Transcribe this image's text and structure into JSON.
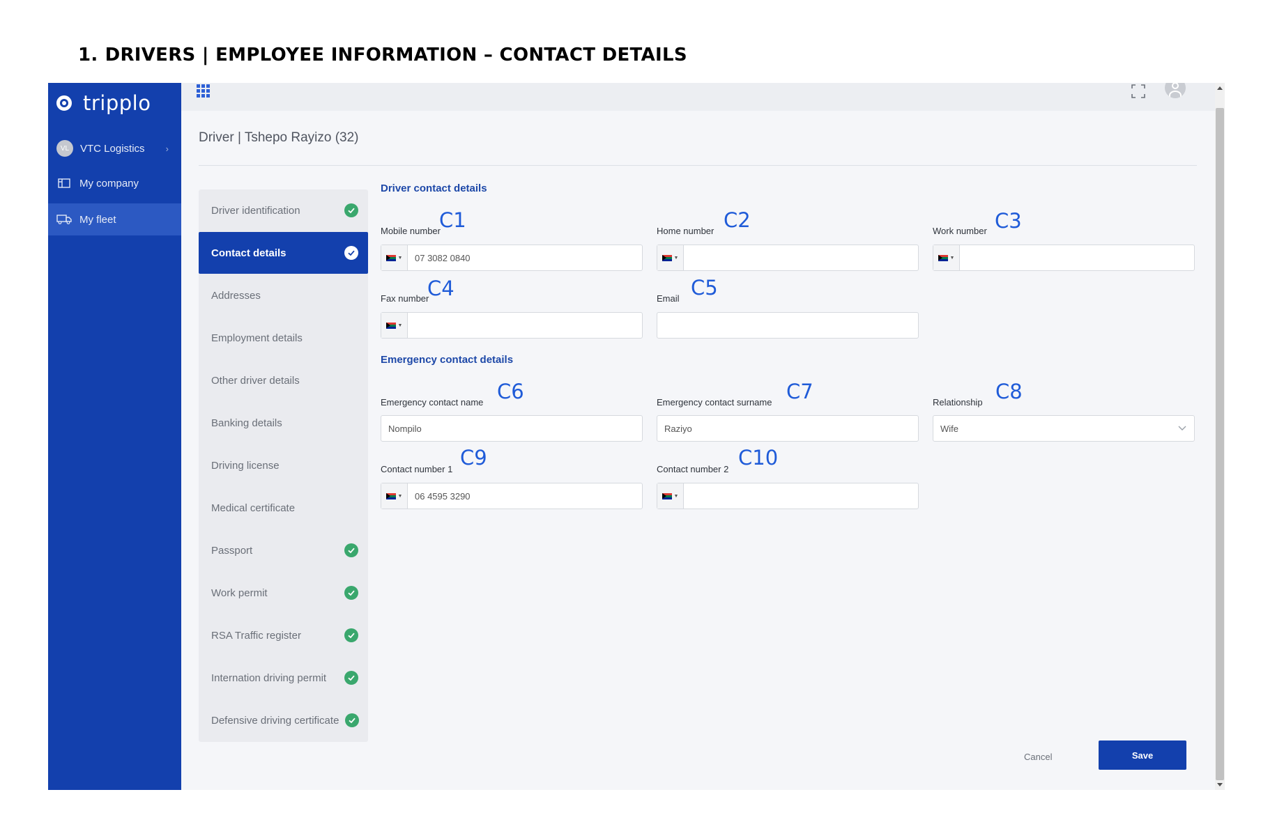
{
  "document": {
    "heading_number": "1.",
    "heading_text": "DRIVERS | EMPLOYEE INFORMATION – CONTACT DETAILS"
  },
  "app": {
    "logo_text": "tripplo",
    "nav": {
      "company_initials": "VL",
      "company_name": "VTC Logistics",
      "my_company": "My company",
      "my_fleet": "My fleet"
    },
    "topbar": {
      "apps_icon": "apps-grid-icon",
      "expand_icon": "expand-icon",
      "user_icon": "user-avatar-icon"
    }
  },
  "page": {
    "title": "Driver | Tshepo Rayizo (32)"
  },
  "tabs": [
    {
      "label": "Driver identification",
      "complete": true,
      "active": false
    },
    {
      "label": "Contact details",
      "complete": true,
      "active": true
    },
    {
      "label": "Addresses",
      "complete": false,
      "active": false
    },
    {
      "label": "Employment details",
      "complete": false,
      "active": false
    },
    {
      "label": "Other driver details",
      "complete": false,
      "active": false
    },
    {
      "label": "Banking details",
      "complete": false,
      "active": false
    },
    {
      "label": "Driving license",
      "complete": false,
      "active": false
    },
    {
      "label": "Medical certificate",
      "complete": false,
      "active": false
    },
    {
      "label": "Passport",
      "complete": true,
      "active": false
    },
    {
      "label": "Work permit",
      "complete": true,
      "active": false
    },
    {
      "label": "RSA Traffic register",
      "complete": true,
      "active": false
    },
    {
      "label": "Internation driving permit",
      "complete": true,
      "active": false
    },
    {
      "label": "Defensive driving certificate",
      "complete": true,
      "active": false
    }
  ],
  "driver_contact": {
    "section_title": "Driver contact details",
    "mobile": {
      "label": "Mobile number",
      "callout": "C1",
      "value": "07 3082 0840"
    },
    "home": {
      "label": "Home number",
      "callout": "C2",
      "value": ""
    },
    "work": {
      "label": "Work number",
      "callout": "C3",
      "value": ""
    },
    "fax": {
      "label": "Fax number",
      "callout": "C4",
      "value": ""
    },
    "email": {
      "label": "Email",
      "callout": "C5",
      "value": ""
    }
  },
  "emergency_contact": {
    "section_title": "Emergency contact details",
    "name": {
      "label": "Emergency contact name",
      "callout": "C6",
      "value": "Nompilo"
    },
    "surname": {
      "label": "Emergency contact surname",
      "callout": "C7",
      "value": "Raziyo"
    },
    "relationship": {
      "label": "Relationship",
      "callout": "C8",
      "value": "Wife"
    },
    "contact1": {
      "label": "Contact number 1",
      "callout": "C9",
      "value": "06 4595 3290"
    },
    "contact2": {
      "label": "Contact number 2",
      "callout": "C10",
      "value": ""
    }
  },
  "actions": {
    "cancel": "Cancel",
    "save": "Save"
  },
  "colors": {
    "brand": "#1340ad",
    "accent": "#1f5bd8",
    "success": "#3aa76d"
  }
}
